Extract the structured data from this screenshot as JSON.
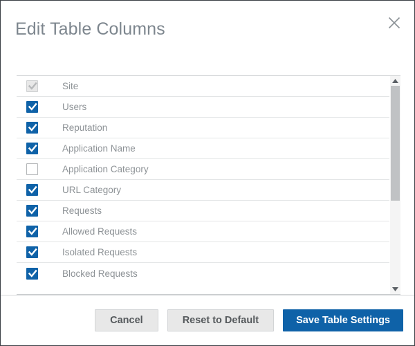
{
  "dialog": {
    "title": "Edit Table Columns",
    "close_icon": "close-icon"
  },
  "columns": [
    {
      "label": "Site",
      "checked": true,
      "disabled": true
    },
    {
      "label": "Users",
      "checked": true,
      "disabled": false
    },
    {
      "label": "Reputation",
      "checked": true,
      "disabled": false
    },
    {
      "label": "Application Name",
      "checked": true,
      "disabled": false
    },
    {
      "label": "Application Category",
      "checked": false,
      "disabled": false
    },
    {
      "label": "URL Category",
      "checked": true,
      "disabled": false
    },
    {
      "label": "Requests",
      "checked": true,
      "disabled": false
    },
    {
      "label": "Allowed Requests",
      "checked": true,
      "disabled": false
    },
    {
      "label": "Isolated Requests",
      "checked": true,
      "disabled": false
    },
    {
      "label": "Blocked Requests",
      "checked": true,
      "disabled": false
    }
  ],
  "scrollbar": {
    "up_arrow_icon": "caret-up-icon",
    "down_arrow_icon": "caret-down-icon",
    "thumb_position_percent": 0,
    "thumb_size_percent": 58
  },
  "footer": {
    "cancel_label": "Cancel",
    "reset_label": "Reset to Default",
    "save_label": "Save Table Settings"
  },
  "colors": {
    "accent": "#0f62a8",
    "title_text": "#7d868e",
    "row_text": "#8d9296",
    "button_face": "#e8e8e8",
    "border": "#3a3f44"
  }
}
